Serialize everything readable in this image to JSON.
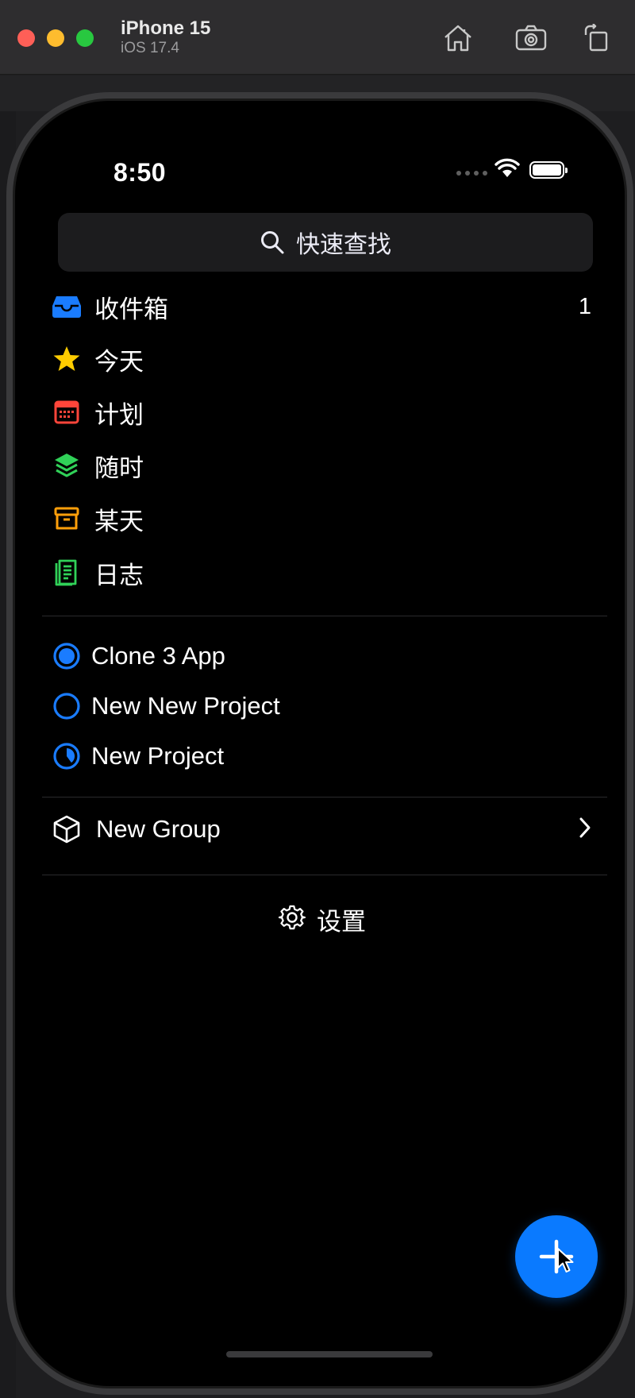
{
  "window": {
    "device_name": "iPhone 15",
    "os_version": "iOS 17.4",
    "toolbar_icons": [
      "home-icon",
      "camera-icon",
      "rotate-icon"
    ]
  },
  "status_bar": {
    "time": "8:50",
    "icons": [
      "wifi-icon",
      "battery-icon"
    ]
  },
  "search": {
    "label": "快速查找",
    "icon": "search-icon"
  },
  "nav": {
    "items": [
      {
        "label": "收件箱",
        "icon": "inbox-icon",
        "count": "1",
        "color": "#1a7cff"
      },
      {
        "label": "今天",
        "icon": "star-icon",
        "color": "#ffcc00"
      },
      {
        "label": "计划",
        "icon": "calendar-icon",
        "color": "#ff453a"
      },
      {
        "label": "随时",
        "icon": "layers-icon",
        "color": "#30d158"
      },
      {
        "label": "某天",
        "icon": "archive-box-icon",
        "color": "#ff9f0a"
      },
      {
        "label": "日志",
        "icon": "logbook-icon",
        "color": "#30d158"
      }
    ]
  },
  "projects": [
    {
      "label": "Clone 3 App",
      "icon": "progress-pie-icon",
      "progress": 1.0
    },
    {
      "label": "New New Project",
      "icon": "progress-pie-icon",
      "progress": 0
    },
    {
      "label": "New Project",
      "icon": "progress-pie-icon",
      "progress": 0.4
    }
  ],
  "group": {
    "label": "New Group",
    "icon": "cube-icon"
  },
  "settings": {
    "label": "设置",
    "icon": "gear-icon"
  },
  "fab": {
    "icon": "plus-icon"
  },
  "colors": {
    "accent": "#0a7aff",
    "background": "#000000",
    "search_bg": "#1c1c1e"
  }
}
